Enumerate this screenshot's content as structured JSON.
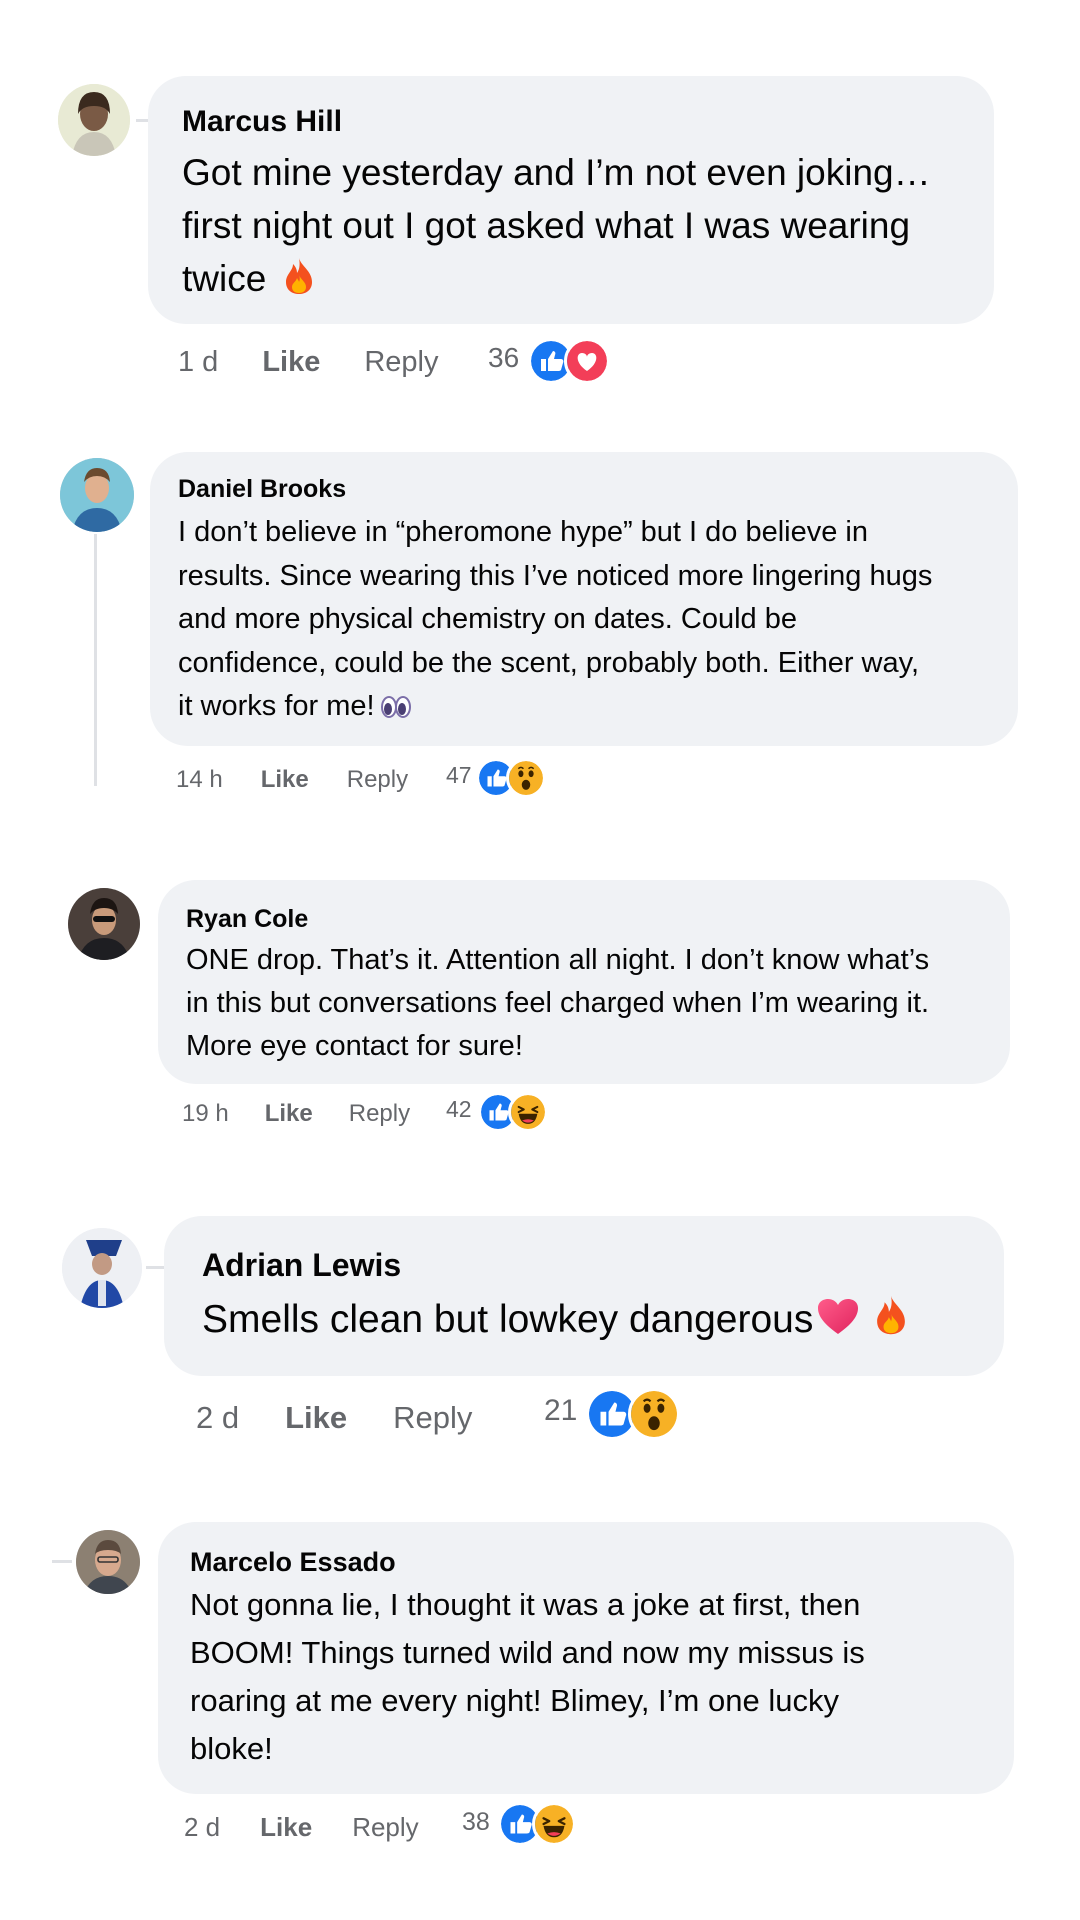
{
  "comments": [
    {
      "name": "Marcus Hill",
      "lines": [
        "Got mine yesterday and I’m not even joking…",
        "first night out I got asked what I was wearing",
        "twice"
      ],
      "time": "1 d",
      "like": "Like",
      "reply": "Reply",
      "reaction_count": "36",
      "reactions": [
        "like-icon",
        "love-icon"
      ]
    },
    {
      "name": "Daniel Brooks",
      "lines": [
        "I don’t believe in “pheromone hype” but I do believe in",
        "results. Since wearing this I’ve noticed more lingering hugs",
        "and more physical chemistry on dates. Could be",
        "confidence, could be the scent, probably both. Either way,",
        "it works for me!"
      ],
      "time": "14 h",
      "like": "Like",
      "reply": "Reply",
      "reaction_count": "47",
      "reactions": [
        "like-icon",
        "wow-icon"
      ]
    },
    {
      "name": "Ryan Cole",
      "lines": [
        "ONE drop. That’s it. Attention all night. I don’t know what’s",
        "in this but conversations feel charged when I’m wearing it.",
        "More eye contact for sure!"
      ],
      "time": "19 h",
      "like": "Like",
      "reply": "Reply",
      "reaction_count": "42",
      "reactions": [
        "like-icon",
        "haha-icon"
      ]
    },
    {
      "name": "Adrian Lewis",
      "lines": [
        "Smells clean but lowkey dangerous"
      ],
      "time": "2 d",
      "like": "Like",
      "reply": "Reply",
      "reaction_count": "21",
      "reactions": [
        "like-icon",
        "wow-icon"
      ]
    },
    {
      "name": "Marcelo Essado",
      "lines": [
        "Not gonna lie, I thought it was a joke at first, then",
        "BOOM! Things turned wild and now my missus is",
        "roaring at me every night! Blimey, I’m one lucky",
        "bloke!"
      ],
      "time": "2 d",
      "like": "Like",
      "reply": "Reply",
      "reaction_count": "38",
      "reactions": [
        "like-icon",
        "haha-icon"
      ]
    }
  ],
  "colors": {
    "like": "#1877f2",
    "love": "#f33e58",
    "bubble": "#f0f2f5",
    "meta": "#65676b"
  }
}
